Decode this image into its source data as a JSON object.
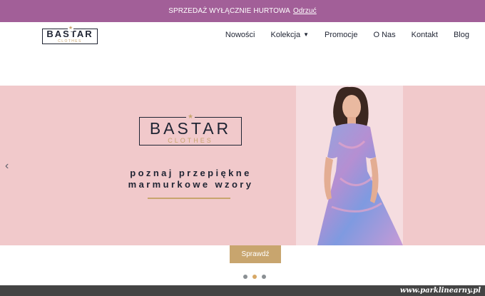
{
  "notice": {
    "text": "SPRZEDAŻ WYŁĄCZNIE HURTOWA",
    "dismiss": "Odrzuć"
  },
  "header": {
    "logo": {
      "main": "BASTAR",
      "sub": "CLOTHES"
    },
    "nav": [
      {
        "label": "Nowości"
      },
      {
        "label": "Kolekcja",
        "has_dropdown": true
      },
      {
        "label": "Promocje"
      },
      {
        "label": "O Nas"
      },
      {
        "label": "Kontakt"
      },
      {
        "label": "Blog"
      }
    ]
  },
  "hero": {
    "logo": {
      "main": "BASTAR",
      "sub": "CLOTHES"
    },
    "tagline_line1": "poznaj przepiękne",
    "tagline_line2": "marmurkowe wzory",
    "cta_label": "Sprawdź",
    "prev_arrow": "‹",
    "background_color": "#f1c9cb",
    "accent_color": "#c8a56e"
  },
  "slider": {
    "slide_count": 3,
    "active_index": 1
  },
  "watermark": "www.parklinearny.pl",
  "colors": {
    "notice_bg": "#a25f98",
    "text_dark": "#1f2433",
    "gold": "#c8a56e"
  }
}
